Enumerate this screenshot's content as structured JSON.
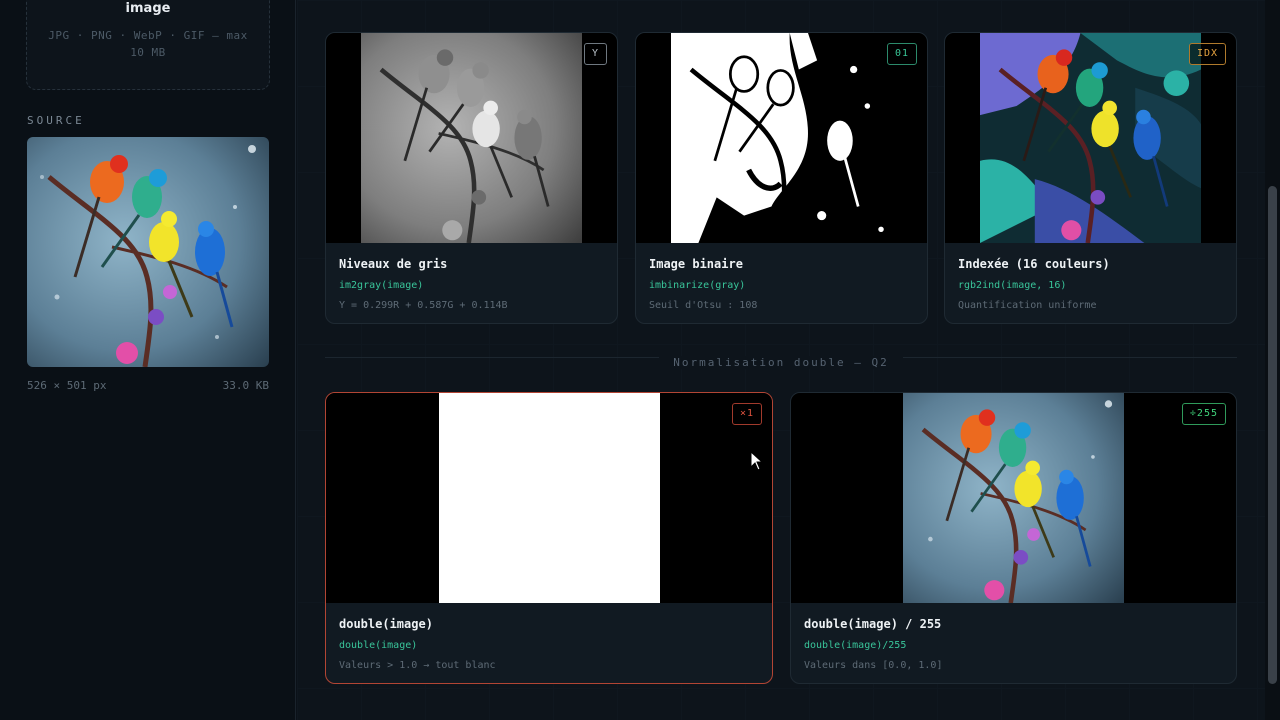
{
  "sidebar": {
    "drop_title": "image",
    "drop_hint": "JPG · PNG · WebP · GIF — max 10 MB",
    "source_label": "SOURCE",
    "source_dims": "526 × 501 px",
    "source_size": "33.0 KB"
  },
  "cards": [
    {
      "title": "Niveaux de gris",
      "code": "im2gray(image)",
      "desc": "Y = 0.299R + 0.587G + 0.114B",
      "badge": "Y",
      "badge_color": "#b8c0c7"
    },
    {
      "title": "Image binaire",
      "code": "imbinarize(gray)",
      "desc": "Seuil d'Otsu : 108",
      "badge": "01",
      "badge_color": "#38c596"
    },
    {
      "title": "Indexée (16 couleurs)",
      "code": "rgb2ind(image, 16)",
      "desc": "Quantification uniforme",
      "badge": "IDX",
      "badge_color": "#e5a23f"
    },
    {
      "title": "double(image)",
      "code": "double(image)",
      "desc": "Valeurs > 1.0 → tout blanc",
      "badge": "×1",
      "badge_color": "#e0533f"
    },
    {
      "title": "double(image) / 255",
      "code": "double(image)/255",
      "desc": "Valeurs dans [0.0, 1.0]",
      "badge": "÷255",
      "badge_color": "#3fd27a"
    }
  ],
  "section_label": "Normalisation double — Q2",
  "icons": {
    "cursor": "mouse-pointer-icon"
  },
  "colors": {
    "accent_code": "#39c59a",
    "danger_border": "#b24534"
  }
}
